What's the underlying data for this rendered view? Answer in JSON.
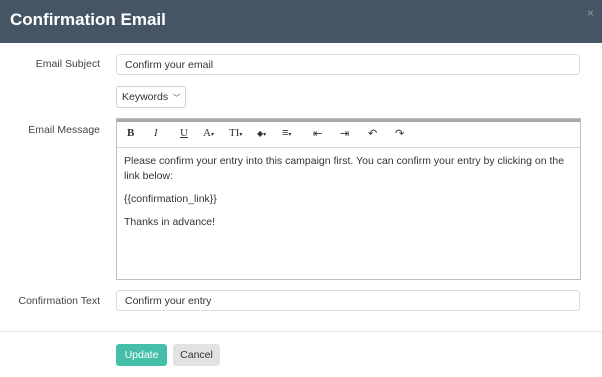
{
  "modal": {
    "title": "Confirmation Email",
    "close_symbol": "×"
  },
  "form": {
    "subject_label": "Email Subject",
    "subject_value": "Confirm your email",
    "keywords_button": "Keywords",
    "message_label": "Email Message",
    "message_paragraphs": [
      "Please confirm your entry into this campaign first. You can confirm your entry by clicking on the link below:",
      "{{confirmation_link}}",
      "Thanks in advance!"
    ],
    "confirmation_text_label": "Confirmation Text",
    "confirmation_text_value": "Confirm your entry"
  },
  "toolbar": {
    "icons": [
      "bold-icon",
      "italic-icon",
      "underline-icon",
      "font-color-icon",
      "font-size-icon",
      "fill-color-icon",
      "align-icon",
      "outdent-icon",
      "indent-icon",
      "undo-icon",
      "redo-icon"
    ],
    "bold": "B",
    "italic": "I",
    "underline": "U",
    "font_color": "A",
    "font_size": "TI",
    "fill": "◆",
    "align": "≡",
    "outdent": "⇤",
    "indent": "⇥",
    "undo": "↶",
    "redo": "↷",
    "caret": "▾"
  },
  "footer": {
    "update_label": "Update",
    "cancel_label": "Cancel"
  },
  "colors": {
    "header_bg": "#465563",
    "update_bg": "#46bfa8",
    "cancel_bg": "#e2e2e2"
  }
}
